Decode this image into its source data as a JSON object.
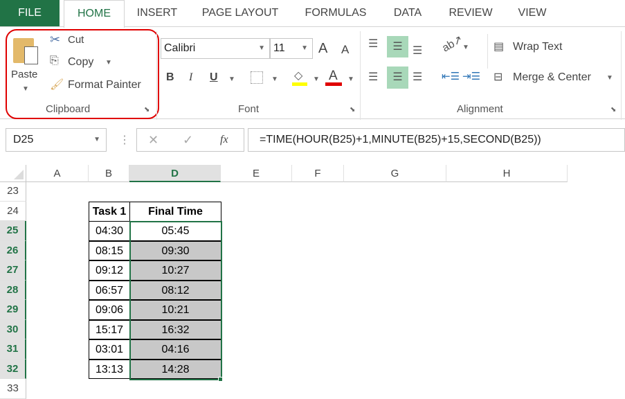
{
  "tabs": [
    {
      "label": "FILE"
    },
    {
      "label": "HOME"
    },
    {
      "label": "INSERT"
    },
    {
      "label": "PAGE LAYOUT"
    },
    {
      "label": "FORMULAS"
    },
    {
      "label": "DATA"
    },
    {
      "label": "REVIEW"
    },
    {
      "label": "VIEW"
    }
  ],
  "clipboard": {
    "paste": "Paste",
    "cut": "Cut",
    "copy": "Copy",
    "format_painter": "Format Painter",
    "group": "Clipboard"
  },
  "font": {
    "name": "Calibri",
    "size": "11",
    "bold": "B",
    "italic": "I",
    "underline": "U",
    "grow": "A",
    "shrink": "A",
    "color_letter": "A",
    "group": "Font",
    "highlight_color": "#ffff00",
    "font_color": "#e00000"
  },
  "alignment": {
    "wrap_text": "Wrap Text",
    "merge_center": "Merge & Center",
    "group": "Alignment"
  },
  "formula_bar": {
    "name_box": "D25",
    "fx": "fx",
    "formula": "=TIME(HOUR(B25)+1,MINUTE(B25)+15,SECOND(B25))"
  },
  "columns": [
    "A",
    "B",
    "D",
    "E",
    "F",
    "G",
    "H"
  ],
  "rows": [
    "23",
    "24",
    "25",
    "26",
    "27",
    "28",
    "29",
    "30",
    "31",
    "32",
    "33"
  ],
  "table": {
    "headers": [
      "Task 1",
      "Final Time"
    ],
    "data": [
      [
        "04:30",
        "05:45"
      ],
      [
        "08:15",
        "09:30"
      ],
      [
        "09:12",
        "10:27"
      ],
      [
        "06:57",
        "08:12"
      ],
      [
        "09:06",
        "10:21"
      ],
      [
        "15:17",
        "16:32"
      ],
      [
        "03:01",
        "04:16"
      ],
      [
        "13:13",
        "14:28"
      ]
    ]
  },
  "colors": {
    "accent": "#217346",
    "highlight_ring": "#e00000"
  }
}
